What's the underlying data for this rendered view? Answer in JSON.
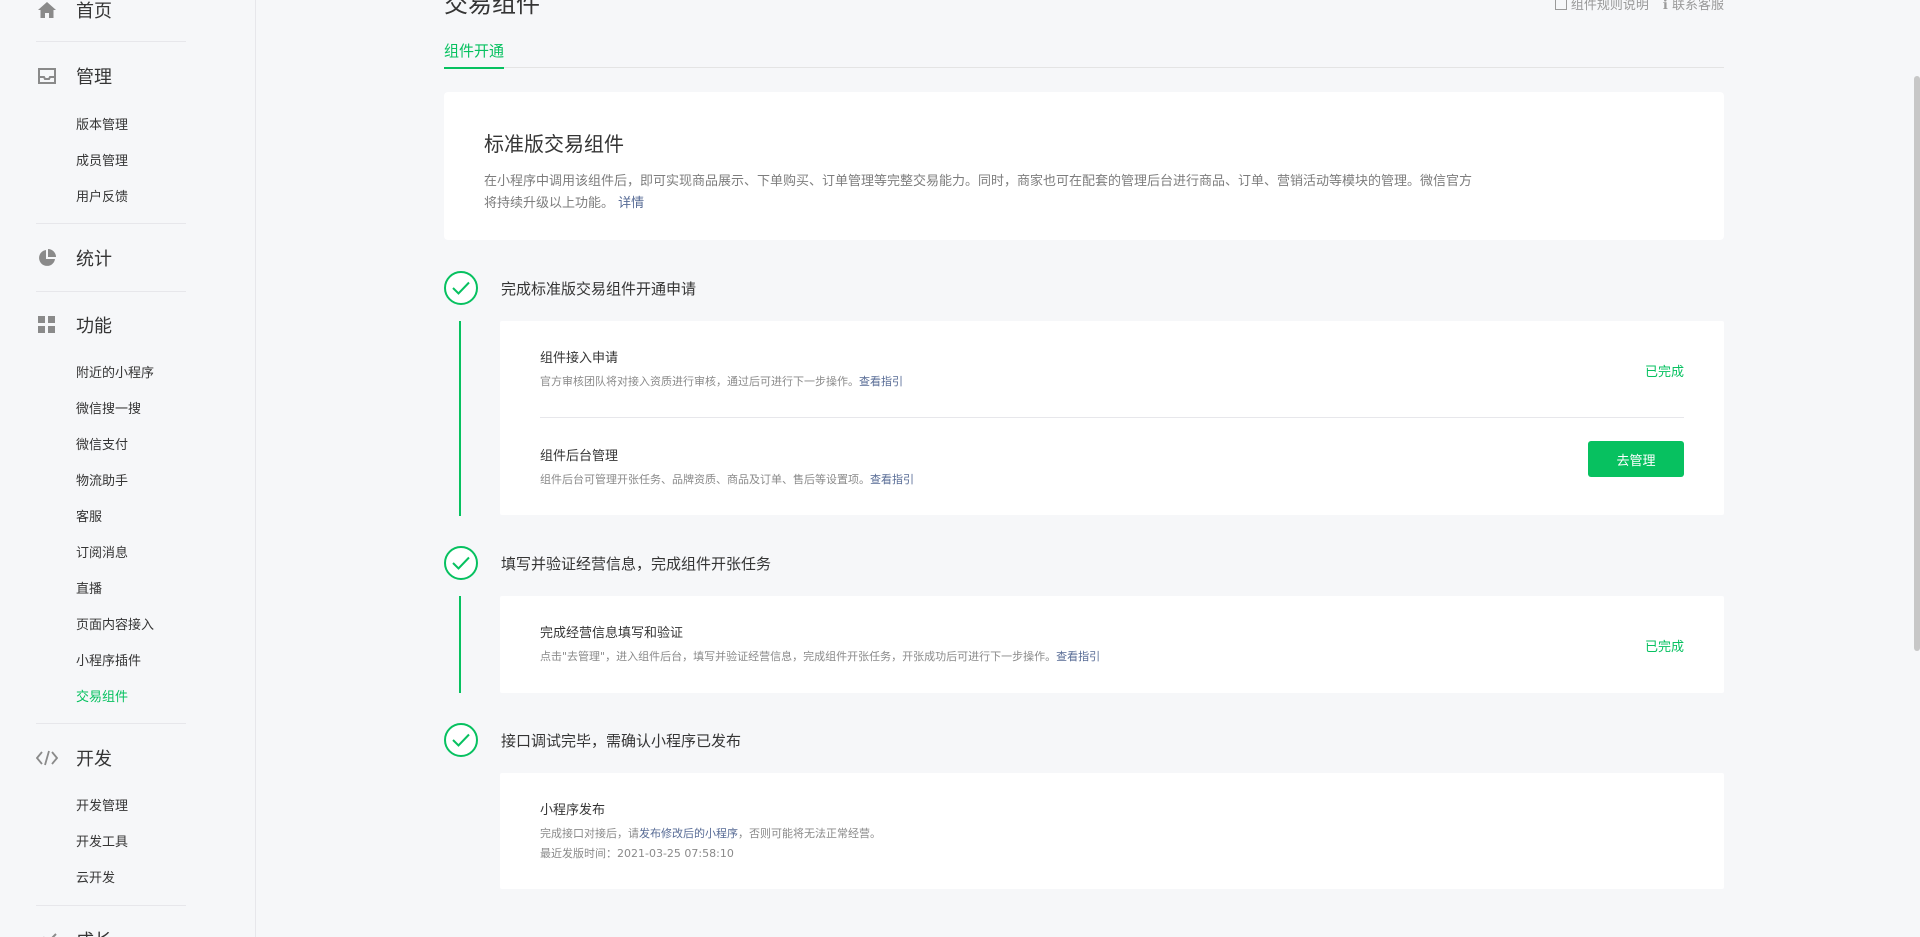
{
  "sidebar": {
    "home": {
      "label": "首页",
      "icon": "home-icon"
    },
    "manage": {
      "label": "管理",
      "icon": "inbox-icon",
      "items": [
        "版本管理",
        "成员管理",
        "用户反馈"
      ]
    },
    "stats": {
      "label": "统计",
      "icon": "pie-chart-icon"
    },
    "features": {
      "label": "功能",
      "icon": "grid-icon",
      "items": [
        "附近的小程序",
        "微信搜一搜",
        "微信支付",
        "物流助手",
        "客服",
        "订阅消息",
        "直播",
        "页面内容接入",
        "小程序插件",
        "交易组件"
      ],
      "active_item": "交易组件"
    },
    "dev": {
      "label": "开发",
      "icon": "code-icon",
      "items": [
        "开发管理",
        "开发工具",
        "云开发"
      ]
    },
    "growth": {
      "label": "成长",
      "icon": "growth-icon"
    }
  },
  "page": {
    "title": "交易组件",
    "links": {
      "rules": "组件规则说明",
      "contact": "联系客服"
    },
    "tab": "组件开通"
  },
  "intro": {
    "title": "标准版交易组件",
    "desc": "在小程序中调用该组件后，即可实现商品展示、下单购买、订单管理等完整交易能力。同时，商家也可在配套的管理后台进行商品、订单、营销活动等模块的管理。微信官方将持续升级以上功能。",
    "detail_link": "详情"
  },
  "steps": [
    {
      "title": "完成标准版交易组件开通申请",
      "rows": [
        {
          "title": "组件接入申请",
          "desc": "官方审核团队将对接入资质进行审核，通过后可进行下一步操作。",
          "link": "查看指引",
          "status": "已完成"
        },
        {
          "title": "组件后台管理",
          "desc": "组件后台可管理开张任务、品牌资质、商品及订单、售后等设置项。",
          "link": "查看指引",
          "button": "去管理"
        }
      ]
    },
    {
      "title": "填写并验证经营信息，完成组件开张任务",
      "rows": [
        {
          "title": "完成经营信息填写和验证",
          "desc": "点击\"去管理\"，进入组件后台，填写并验证经营信息，完成组件开张任务，开张成功后可进行下一步操作。",
          "link": "查看指引",
          "status": "已完成"
        }
      ]
    },
    {
      "title": "接口调试完毕，需确认小程序已发布",
      "rows": [
        {
          "title": "小程序发布",
          "desc_prefix": "完成接口对接后，请",
          "desc_link": "发布修改后的小程序",
          "desc_suffix": "，否则可能将无法正常经营。",
          "desc2": "最近发版时间：2021-03-25 07:58:10"
        }
      ]
    }
  ]
}
